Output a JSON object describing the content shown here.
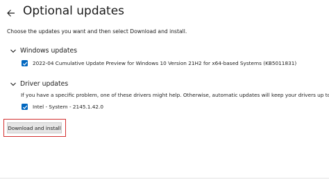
{
  "header": {
    "title": "Optional updates",
    "back_icon": "back-arrow-icon"
  },
  "subtitle": "Choose the updates you want and then select Download and install.",
  "windows_updates": {
    "title": "Windows updates",
    "items": [
      {
        "label": "2022-04 Cumulative Update Preview for Windows 10 Version 21H2 for x64-based Systems (KB5011831)",
        "checked": true
      }
    ]
  },
  "driver_updates": {
    "title": "Driver updates",
    "info": "If you have a specific problem, one of these drivers might help. Otherwise, automatic updates will keep your drivers up to date.",
    "items": [
      {
        "label": "Intel - System - 2145.1.42.0",
        "checked": true
      }
    ]
  },
  "actions": {
    "download_label": "Download and install"
  },
  "colors": {
    "accent": "#0067c0",
    "highlight": "#d32f2f",
    "button_bg": "#e5e5e5"
  }
}
